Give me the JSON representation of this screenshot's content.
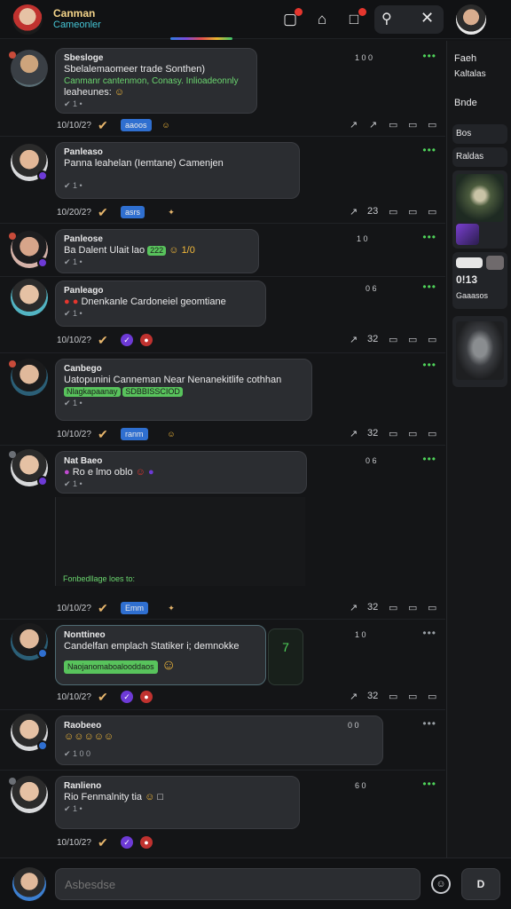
{
  "header": {
    "title": "Canman",
    "subtitle": "Cameonler"
  },
  "colors": {
    "accent_green": "#4fd35a",
    "bubble_bg": "#2b2d31",
    "background": "#141517",
    "title_gold": "#f4d48a",
    "subtitle_cyan": "#46c6d6",
    "link_blue": "#2f6fd0"
  },
  "icons": [
    "notification-icon",
    "home-icon",
    "bookmark-icon",
    "search-icon",
    "close-icon"
  ],
  "posts": [
    {
      "name": "Sbesloge",
      "text": "Sbelalemaomeer trade Sonthen)",
      "green": "Canmanr cantenmon, Conasy. Inlioadeonnly",
      "text2": "leaheunes:",
      "meta": "✔ 1 •",
      "counter": "1 0 0",
      "time": "10/10/2?",
      "tag": "aaoos",
      "actions": [
        "↗",
        "↗",
        "▭",
        "▭",
        "▭"
      ]
    },
    {
      "name": "Panleaso",
      "text": "Panna leahelan (Iemtane) Camenjen",
      "meta": "✔ 1 •",
      "time": "10/20/2?",
      "tag": "asrs",
      "actions": [
        "↗",
        "23",
        "▭",
        "▭",
        "▭"
      ]
    },
    {
      "name": "Panleose",
      "text": "Ba Dalent Ulait lao",
      "chip": "222",
      "text3": "1/0",
      "meta": "✔ 1 •",
      "counter": "1 0"
    },
    {
      "name": "Panleago",
      "text": "Dnenkanle Cardoneiel geomtiane",
      "meta": "✔ 1 •",
      "counter": "0 6",
      "time": "10/10/2?",
      "actions": [
        "↗",
        "32",
        "▭",
        "▭",
        "▭"
      ]
    },
    {
      "name": "Canbego",
      "text": "Uatopunini Canneman Near Nenanekitlife cothhan",
      "green": "Nlagkapaanay",
      "chip": "SDBBISSCIOD",
      "meta": "✔ 1 •",
      "time": "10/10/2?",
      "tag": "ranm",
      "actions": [
        "↗",
        "32",
        "▭",
        "▭",
        "▭"
      ]
    },
    {
      "name": "Nat Baeo",
      "text": "Ro e lmo oblo",
      "meta": "✔ 1 •",
      "counter": "0 6",
      "footer": "Fonbedllage loes to:",
      "time": "10/10/2?",
      "tag": "Emm",
      "actions": [
        "↗",
        "32",
        "▭",
        "▭",
        "▭"
      ]
    },
    {
      "name": "Nonttineo",
      "text": "Candelfan emplach Statiker i; demnokke",
      "chip": "Naojanomaboalooddaos",
      "side_num": "7",
      "counter": "1 0",
      "time": "10/10/2?",
      "actions": [
        "↗",
        "32",
        "▭",
        "▭",
        "▭"
      ]
    },
    {
      "name": "Raobeeo",
      "text": "☺☺☺☺☺",
      "meta": "✔ 1 0 0",
      "counter": "0 0",
      "time": "10/10/2?",
      "actions": [
        "↗",
        "32",
        "▭",
        "▭",
        "▭"
      ]
    },
    {
      "name": "Ranlieno",
      "text": "Rio Fenmalnity tia",
      "meta": "✔ 1 •",
      "counter": "6 0",
      "time": "10/10/2?"
    }
  ],
  "right_panel": {
    "title": "Faeh",
    "subtitle": "Kaltalas",
    "label": "Bnde",
    "item1": "Bos",
    "item2": "Raldas",
    "stat": "0!13",
    "stat_sub": "Gaaasos"
  },
  "composer": {
    "placeholder": "Asbesdse",
    "send_label": "D"
  }
}
